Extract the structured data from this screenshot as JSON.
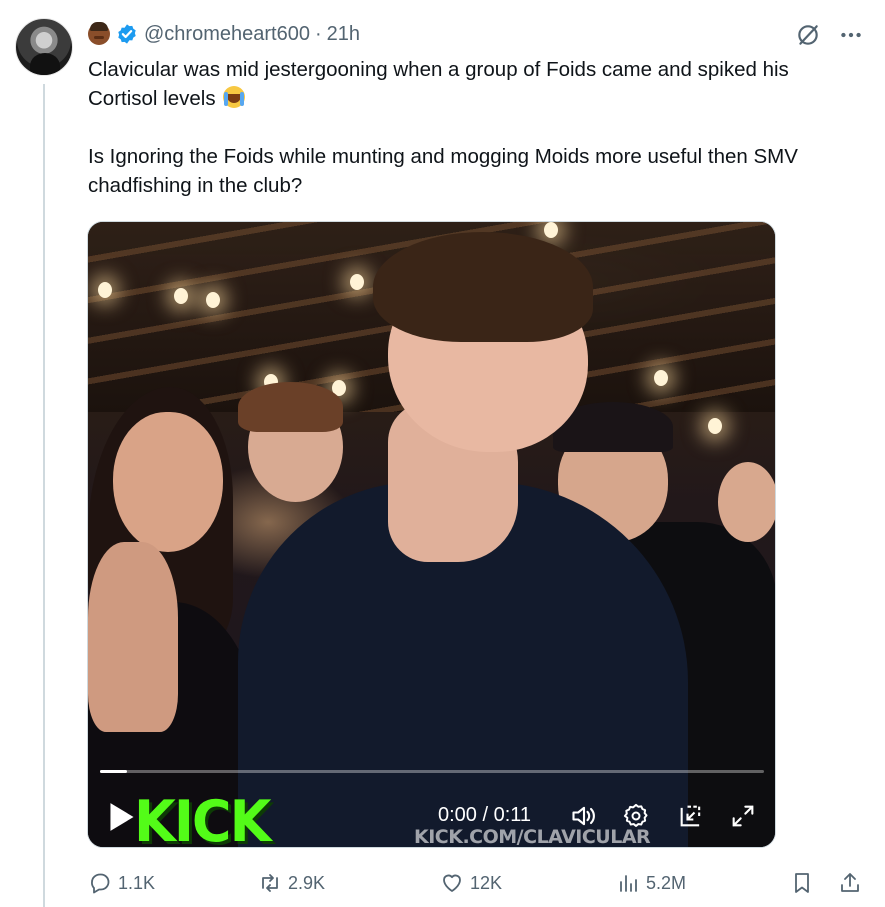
{
  "author": {
    "handle": "@chromeheart600",
    "separator": "·",
    "time": "21h",
    "verified": true,
    "avatar_icon": "avatar",
    "profile_emoji": "face-emoji"
  },
  "tweet": {
    "paragraph1": "Clavicular was mid jestergooning when a group of Foids came and spiked his Cortisol levels",
    "paragraph1_emoji": "loudly-crying-face-emoji",
    "paragraph2": "Is Ignoring the Foids while munting and mogging Moids more useful then SMV chadfishing in the club?"
  },
  "video": {
    "time_display": "0:00 / 0:11",
    "progress": 0.04,
    "watermark_logo": "KICK",
    "watermark_url": "KICK.COM/CLAVICULAR",
    "accent_color": "#53fc18"
  },
  "actions": {
    "replies": "1.1K",
    "reposts": "2.9K",
    "likes": "12K",
    "views": "5.2M"
  },
  "colors": {
    "secondary_text": "#536471",
    "verified_blue": "#1d9bf0",
    "thread_line": "#cfd9de"
  }
}
